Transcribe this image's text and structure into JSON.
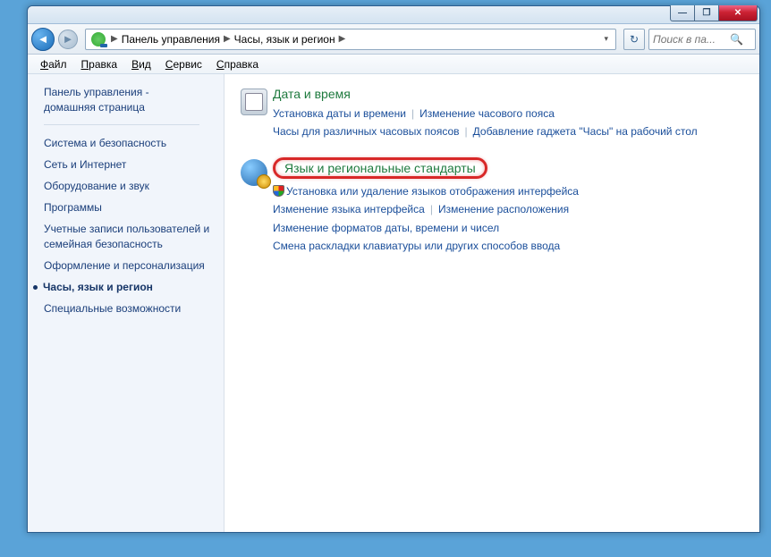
{
  "titlebar": {
    "min": "—",
    "max": "❐",
    "close": "✕"
  },
  "nav": {
    "crumb1": "Панель управления",
    "crumb2": "Часы, язык и регион",
    "sep": "▶",
    "searchPlaceholder": "Поиск в па..."
  },
  "menu": {
    "file": "айл",
    "edit": "равка",
    "view": "ид",
    "tools": "ервис",
    "help": "правка",
    "fileU": "Ф",
    "editU": "П",
    "viewU": "В",
    "toolsU": "С",
    "helpU": "С"
  },
  "sidebar": {
    "home1": "Панель управления -",
    "home2": "домашняя страница",
    "items": [
      {
        "label": "Система и безопасность"
      },
      {
        "label": "Сеть и Интернет"
      },
      {
        "label": "Оборудование и звук"
      },
      {
        "label": "Программы"
      },
      {
        "label": "Учетные записи пользователей и семейная безопасность"
      },
      {
        "label": "Оформление и персонализация"
      },
      {
        "label": "Часы, язык и регион",
        "active": true
      },
      {
        "label": "Специальные возможности"
      }
    ]
  },
  "sections": [
    {
      "title": "Дата и время",
      "rows": [
        [
          "Установка даты и времени",
          "Изменение часового пояса"
        ],
        [
          "Часы для различных часовых поясов",
          "Добавление гаджета \"Часы\" на рабочий стол"
        ]
      ],
      "highlight": false
    },
    {
      "title": "Язык и региональные стандарты",
      "rows": [
        [
          {
            "shield": true,
            "t": "Установка или удаление языков отображения интерфейса"
          }
        ],
        [
          "Изменение языка интерфейса",
          "Изменение расположения"
        ],
        [
          "Изменение форматов даты, времени и чисел"
        ],
        [
          "Смена раскладки клавиатуры или других способов ввода"
        ]
      ],
      "highlight": true
    }
  ]
}
